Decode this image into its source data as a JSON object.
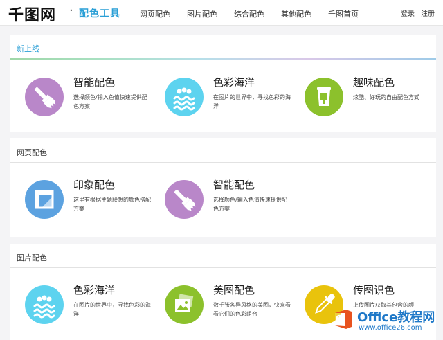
{
  "header": {
    "logo": "千图网",
    "sub_brand": "配色工具",
    "nav": [
      "网页配色",
      "图片配色",
      "综合配色",
      "其他配色",
      "千图首页"
    ],
    "login": "登录",
    "register": "注册"
  },
  "sections": [
    {
      "title": "新上线",
      "cards": [
        {
          "title": "智能配色",
          "desc": "选择颜色/输入色值快速提供配色方案",
          "icon": "brush-icon",
          "color": "#b987c9"
        },
        {
          "title": "色彩海洋",
          "desc": "在图片的世界中，寻找色彩的海洋",
          "icon": "waves-icon",
          "color": "#5dd3ef"
        },
        {
          "title": "趣味配色",
          "desc": "炫酷、好玩的自由配色方式",
          "icon": "paint-bucket-icon",
          "color": "#8cc12c"
        }
      ]
    },
    {
      "title": "网页配色",
      "cards": [
        {
          "title": "印象配色",
          "desc": "这里有根据主题联想的颜色搭配方案",
          "icon": "ruler-frame-icon",
          "color": "#5ca2e0"
        },
        {
          "title": "智能配色",
          "desc": "选择颜色/输入色值快速提供配色方案",
          "icon": "brush-icon",
          "color": "#b987c9"
        }
      ]
    },
    {
      "title": "图片配色",
      "cards": [
        {
          "title": "色彩海洋",
          "desc": "在图片的世界中，寻找色彩的海洋",
          "icon": "waves-icon",
          "color": "#5dd3ef"
        },
        {
          "title": "美图配色",
          "desc": "数千张各异风格的美图，快来看看它们的色彩组合",
          "icon": "image-gallery-icon",
          "color": "#8cc12c"
        },
        {
          "title": "传图识色",
          "desc": "上传图片获取其包含的颜",
          "icon": "eyedropper-icon",
          "color": "#e9c30c"
        }
      ]
    }
  ],
  "watermark": {
    "name": "Office教程网",
    "url": "www.office26.com"
  }
}
